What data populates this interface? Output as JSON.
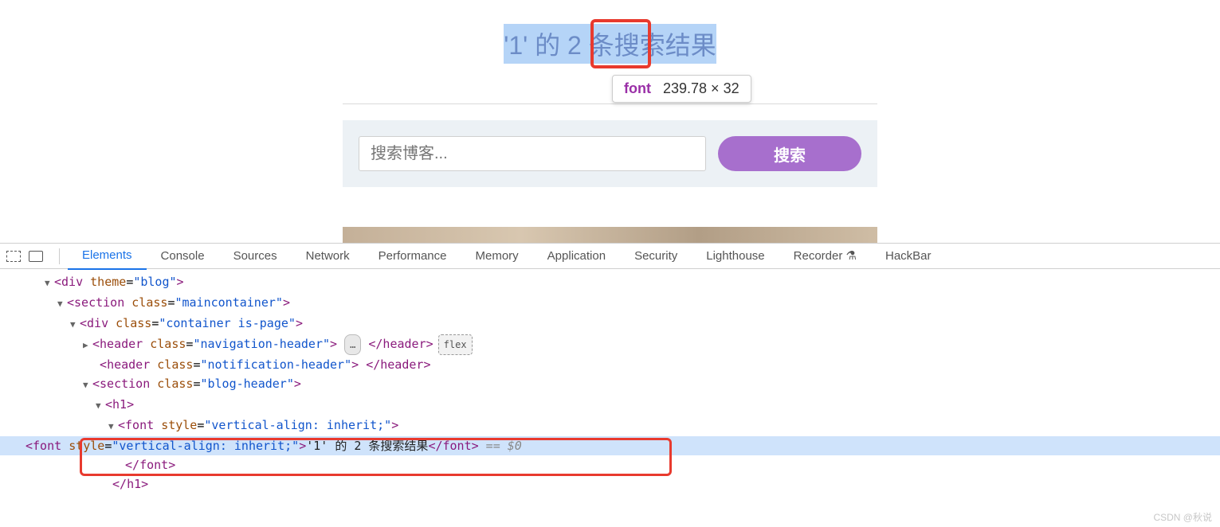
{
  "page": {
    "heading": "'1' 的 2 条搜索结果",
    "tooltip_tag": "font",
    "tooltip_dim": "239.78 × 32",
    "search_placeholder": "搜索博客...",
    "search_button": "搜索"
  },
  "devtools": {
    "tabs": [
      "Elements",
      "Console",
      "Sources",
      "Network",
      "Performance",
      "Memory",
      "Application",
      "Security",
      "Lighthouse",
      "Recorder",
      "HackBar"
    ],
    "active_tab": "Elements",
    "selected_ref": " == $0",
    "dots": "…",
    "flex_badge": "flex",
    "dom": {
      "l1": {
        "tag": "div",
        "attr": "theme",
        "val": "blog"
      },
      "l2": {
        "tag": "section",
        "attr": "class",
        "val": "maincontainer"
      },
      "l3": {
        "tag": "div",
        "attr": "class",
        "val": "container is-page"
      },
      "l4": {
        "tag": "header",
        "attr": "class",
        "val": "navigation-header"
      },
      "l5": {
        "tag": "header",
        "attr": "class",
        "val": "notification-header"
      },
      "l6": {
        "tag": "section",
        "attr": "class",
        "val": "blog-header"
      },
      "l7": {
        "tag": "h1"
      },
      "l8": {
        "tag": "font",
        "attr": "style",
        "val": "vertical-align: inherit;"
      },
      "l9": {
        "tag": "font",
        "attr": "style",
        "val": "vertical-align: inherit;",
        "text": "'1' 的 2 条搜索结果"
      }
    }
  },
  "watermark": "CSDN @秋说"
}
